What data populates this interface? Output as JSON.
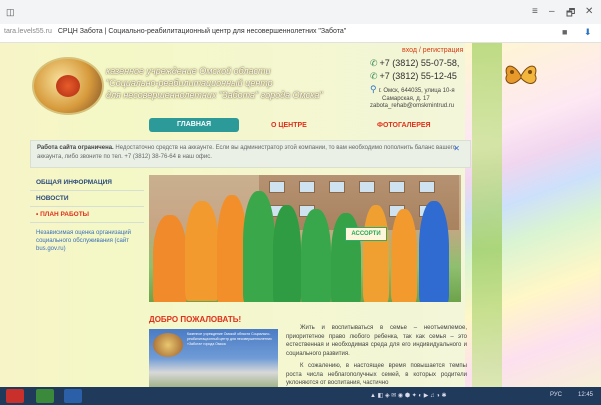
{
  "browser": {
    "domain": "tara.levels55.ru",
    "tab_title": "СРЦН Забота | Социально-реабилитационный центр для несовершеннолетних \"Забота\"",
    "window_controls": [
      "≡",
      "–",
      "🗗",
      "✕"
    ]
  },
  "header": {
    "org_name_lines": [
      "казенное учреждение Омской области",
      "\"Социально-реабилитационный центр",
      "для несовершеннолетних \"Забота\" города Омска\""
    ],
    "login_link": "вход / регистрация",
    "phones": [
      "+7 (3812) 55-07-58,",
      "+7 (3812) 55-12-45"
    ],
    "address_lines": [
      "г. Омск, 644035, улица 10-я",
      "Самарская, д. 17"
    ],
    "email": "zabota_rehab@omskmintrud.ru"
  },
  "nav": {
    "items": [
      "ГЛАВНАЯ",
      "О ЦЕНТРЕ",
      "ФОТОГАЛЕРЕЯ"
    ]
  },
  "notice": {
    "title": "Работа сайта ограничена.",
    "text": "Недостаточно средств на аккаунте. Если вы администратор этой компании, то вам необходимо пополнить баланс вашего аккаунта, либо звоните по тел. +7 (3812) 38-76-64 в наш офис.",
    "close": "✕"
  },
  "sidebar": {
    "items": [
      "ОБЩАЯ ИНФОРМАЦИЯ",
      "НОВОСТИ",
      "• ПЛАН РАБОТЫ"
    ],
    "link": "Независимая оценка организаций социального обслуживания (сайт bus.gov.ru)"
  },
  "photo": {
    "banner": "АССОРТИ"
  },
  "article": {
    "heading": "ДОБРО ПОЖАЛОВАТЬ!",
    "image_caption": "Казенное учреждение Омской области Социально-реабилитационный центр для несовершеннолетних «Забота» города Омска",
    "paragraphs": [
      "Жить и воспитываться в семье – неотъемлемое, приоритетное право любого ребенка, так как семья – это естественная и необходимая среда для его индивидуального и социального развития.",
      "К сожалению, в настоящее время повышается темпы роста числа неблагополучных семей, в которых родители уклоняются от воспитания, частично"
    ]
  },
  "taskbar": {
    "lang": "РУС",
    "time": "12:45"
  },
  "colors": {
    "accent": "#2d9a9a",
    "link_red": "#e0301a",
    "taskbar": "#203a5c"
  }
}
